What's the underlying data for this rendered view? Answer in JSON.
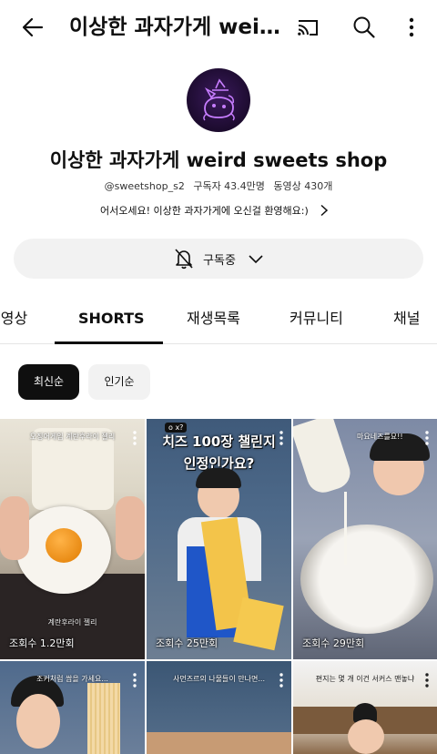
{
  "header": {
    "title": "이상한 과자가게  weird sweets shop",
    "icons": {
      "back": "back-arrow-icon",
      "cast": "cast-icon",
      "search": "search-icon",
      "more": "more-vertical-icon"
    }
  },
  "channel": {
    "name": "이상한 과자가게  weird sweets shop",
    "handle": "@sweetshop_s2",
    "subscribers": "구독자 43.4만명",
    "videos": "동영상 430개",
    "description": "어서오세요! 이상한 과자가게에 오신걸 환영해요:)"
  },
  "subscribe": {
    "label": "구독중"
  },
  "tabs": [
    {
      "label": "동영상"
    },
    {
      "label": "SHORTS"
    },
    {
      "label": "재생목록"
    },
    {
      "label": "커뮤니티"
    },
    {
      "label": "채널"
    }
  ],
  "filters": {
    "latest": "최신순",
    "popular": "인기순"
  },
  "shorts": [
    {
      "caption": "오징어게임 계란후라이 젤리",
      "label": "계란후라이 젤리",
      "views": "조회수 1.2만회"
    },
    {
      "badge": "o x?",
      "title1": "치즈 100장 챌린지",
      "title2": "인정인가요?",
      "views": "조회수 25만회"
    },
    {
      "caption": "마요네즈를요!!",
      "views": "조회수 29만회"
    },
    {
      "caption": "조커처럼 쌈을 가세요..."
    },
    {
      "caption": "사먼즈르의 나물들이 만나면..."
    },
    {
      "caption": "편지는 몇 개 이건 서커스 맨놓냐"
    }
  ],
  "colors": {
    "accent": "#0f0f0f",
    "chip_bg": "#f2f2f2",
    "avatar_bg": "#1c0b2e"
  }
}
